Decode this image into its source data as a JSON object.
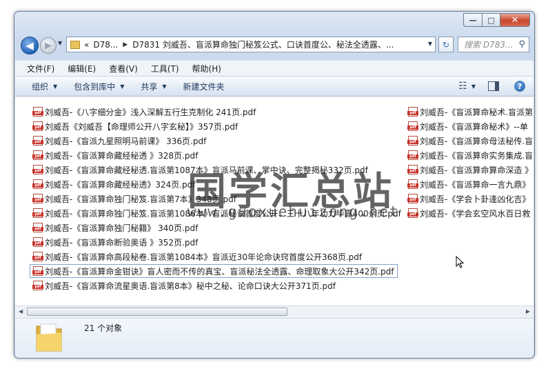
{
  "window": {
    "controls": {
      "minimize": "—",
      "maximize": "□",
      "close": "✕"
    }
  },
  "nav": {
    "back_glyph": "◀",
    "forward_glyph": "▶",
    "breadcrumb_overflow": "«",
    "breadcrumb": [
      "D78...",
      "D7831 刘威吾、盲派算命独门秘笈公式、口诀首度公、秘法全透露、..."
    ],
    "search_placeholder": "搜索 D783...",
    "refresh_glyph": "↻",
    "search_glyph": "⚲"
  },
  "menu": [
    "文件(F)",
    "编辑(E)",
    "查看(V)",
    "工具(T)",
    "帮助(H)"
  ],
  "toolbar": {
    "organize": "组织",
    "include_library": "包含到库中",
    "share": "共享",
    "new_folder": "新建文件夹",
    "help": "?"
  },
  "files_left": [
    "刘威吾-《八字细分金》浅入深解五行生克制化 241页.pdf",
    "刘威吾《刘威吾【命理师公开八字玄秘】》357页.pdf",
    "刘威吾-《盲派九星照明马前课》 336页.pdf",
    "刘威吾-《盲派算命藏经秘透 》328页.pdf",
    "刘威吾-《盲派算命藏经秘透.盲派第1087本》盲派马前课、掌中诀、完整揭秘332页.pdf",
    "刘威吾-《盲派算命藏经秘透》324页.pdf",
    "刘威吾-《盲派算命独门秘笈.盲派第7本》348页.pdf",
    "刘威吾-《盲派算命独门秘笈.盲派第1086本》盲派秘诀首度公开、三十八年功力毕露400余页.pdf",
    "刘威吾-《盲派算命独门秘籍》 340页.pdf",
    "刘威吾-《盲派算命断验奥语 》352页.pdf",
    "刘威吾-《盲派算命高段秘卷.盲派第1084本》盲派近30年论命诀窍首度公开368页.pdf",
    "刘威吾-《盲派算命金钳诀》盲人密而不传的真宝、盲派秘法全透露、命理取象大公开342页.pdf",
    "刘威吾-《盲派算命流星奥语.盲派第8本》秘中之秘、论命口诀大公开371页.pdf"
  ],
  "files_right": [
    "刘威吾-《盲派算命秘术.盲派第",
    "刘威吾-《盲派算命秘术》--单",
    "刘威吾-《盲派算命母法秘传.盲",
    "刘威吾-《盲派算命实务集成.盲",
    "刘威吾-《盲派算命算命深造 》",
    "刘威吾-《盲派算命一言九鼎》",
    "刘威吾-《学会卜卦逢凶化吉》",
    "刘威吾-《学会玄空风水百日救"
  ],
  "selected_index": 11,
  "watermark": {
    "cn": "国学汇总站",
    "en": "www.guoxuehuizong.net"
  },
  "status": {
    "count": "21 个对象"
  },
  "scroll_arrows": {
    "left": "◀",
    "right": "▶"
  }
}
